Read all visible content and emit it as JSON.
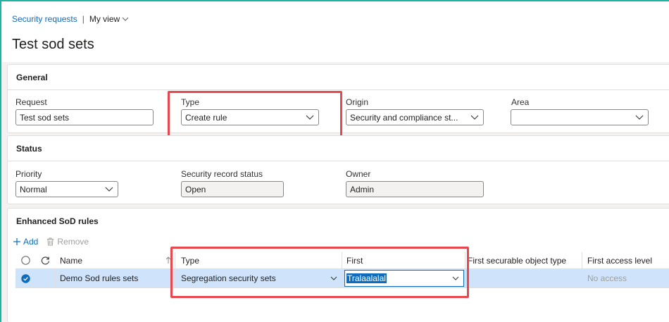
{
  "breadcrumb": {
    "link": "Security requests",
    "separator": "|",
    "view": "My view"
  },
  "page_title": "Test sod sets",
  "general": {
    "title": "General",
    "request_label": "Request",
    "request_value": "Test sod sets",
    "type_label": "Type",
    "type_value": "Create rule",
    "origin_label": "Origin",
    "origin_value": "Security and compliance st...",
    "area_label": "Area",
    "area_value": ""
  },
  "status": {
    "title": "Status",
    "priority_label": "Priority",
    "priority_value": "Normal",
    "record_status_label": "Security record status",
    "record_status_value": "Open",
    "owner_label": "Owner",
    "owner_value": "Admin"
  },
  "sod": {
    "title": "Enhanced SoD rules",
    "add_label": "Add",
    "remove_label": "Remove",
    "columns": {
      "name": "Name",
      "type": "Type",
      "first": "First",
      "first_securable": "First securable object type",
      "first_access": "First access level"
    },
    "rows": [
      {
        "name": "Demo Sod rules sets",
        "type": "Segregation security sets",
        "first": "Tralaalalal",
        "first_securable": "",
        "first_access": "No access"
      }
    ]
  },
  "colors": {
    "accent": "#0f6cbd",
    "highlight": "#e8474e",
    "selected_row": "#cfe4fa",
    "frame": "#21b3a2"
  }
}
